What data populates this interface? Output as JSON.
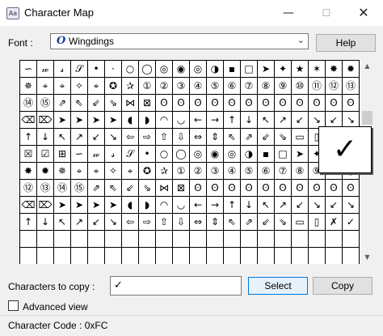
{
  "window": {
    "title": "Character Map",
    "minimize_glyph": "—",
    "maximize_glyph": "☐",
    "close_glyph": "✕"
  },
  "font": {
    "label": "Font :",
    "value": "Wingdings",
    "font_icon": "O",
    "chevron": "⌄"
  },
  "buttons": {
    "help": "Help",
    "select": "Select",
    "copy": "Copy"
  },
  "grid": {
    "selected_index": 158,
    "cells": [
      "∽",
      "𝓌",
      "𝓈",
      "𝒮",
      "•",
      "·",
      "○",
      "◯",
      "◎",
      "◉",
      "◎",
      "◑",
      "▪",
      "□",
      "➤",
      "✦",
      "★",
      "✶",
      "✸",
      "✹",
      "✵",
      "⌖",
      "⌖",
      "✧",
      "⌖",
      "✪",
      "✰",
      "①",
      "②",
      "③",
      "④",
      "⑤",
      "⑥",
      "⑦",
      "⑧",
      "⑨",
      "⑩",
      "⑪",
      "⑫",
      "⑬",
      "⑭",
      "⑮",
      "⇗",
      "⇖",
      "⇙",
      "⇘",
      "⋈",
      "⊠",
      "ʘ",
      "ʘ",
      "ʘ",
      "ʘ",
      "ʘ",
      "ʘ",
      "ʘ",
      "ʘ",
      "ʘ",
      "ʘ",
      "ʘ",
      "ʘ",
      "⌫",
      "⌦",
      "➤",
      "➤",
      "➤",
      "➤",
      "◖",
      "◗",
      "◠",
      "◡",
      "←",
      "→",
      "↑",
      "↓",
      "↖",
      "↗",
      "↙",
      "↘",
      "↙",
      "↘",
      "↑",
      "↓",
      "↖",
      "↗",
      "↙",
      "↘",
      "⇦",
      "⇨",
      "⇧",
      "⇩",
      "⇔",
      "⇕",
      "⇖",
      "⇗",
      "⇙",
      "⇘",
      "▭",
      "▯",
      "✗",
      "✓",
      "☒",
      "☑",
      "⊞",
      "∽",
      "𝓌",
      "𝓈",
      "𝒮",
      "•",
      "○",
      "◯",
      "◎",
      "◉",
      "◎",
      "◑",
      "▪",
      "□",
      "➤",
      "✦",
      "★",
      "✶",
      "✸",
      "✹",
      "✵",
      "⌖",
      "⌖",
      "✧",
      "⌖",
      "✪",
      "✰",
      "①",
      "②",
      "③",
      "④",
      "⑤",
      "⑥",
      "⑦",
      "⑧",
      "⑨",
      "⑩",
      "⑪",
      "⑫",
      "⑬",
      "⑭",
      "⑮",
      "⇗",
      "⇖",
      "⇙",
      "⇘",
      "⋈",
      "⊠",
      "ʘ",
      "ʘ",
      "ʘ",
      "ʘ",
      "ʘ",
      "ʘ",
      "ʘ",
      "ʘ",
      "ʘ",
      "ʘ",
      "⌫",
      "⌦",
      "➤",
      "➤",
      "➤",
      "➤",
      "◖",
      "◗",
      "◠",
      "◡",
      "←",
      "→",
      "↑",
      "↓",
      "↖",
      "↗",
      "↙",
      "↘",
      "↙",
      "↘",
      "↑",
      "↓",
      "↖",
      "↗",
      "↙",
      "↘",
      "⇦",
      "⇨",
      "⇧",
      "⇩",
      "⇔",
      "⇕",
      "⇖",
      "⇗",
      "⇙",
      "⇘",
      "▭",
      "▯",
      "✗",
      "✓",
      "",
      "",
      "",
      "",
      "",
      "",
      "",
      "",
      "",
      "",
      "",
      "",
      "",
      "",
      "",
      "",
      "",
      "",
      "",
      "",
      "",
      "",
      "",
      "",
      "",
      "",
      "",
      "",
      "",
      "",
      "",
      "",
      "",
      "",
      "",
      "",
      "",
      "",
      "",
      ""
    ]
  },
  "zoom": {
    "glyph": "✓"
  },
  "scrollbar": {
    "up_arrow": "▲",
    "down_arrow": "▼"
  },
  "copy_field": {
    "label": "Characters to copy :",
    "value": "✓"
  },
  "advanced": {
    "label": "Advanced view",
    "checked": false
  },
  "status": {
    "text": "Character Code : 0xFC"
  }
}
